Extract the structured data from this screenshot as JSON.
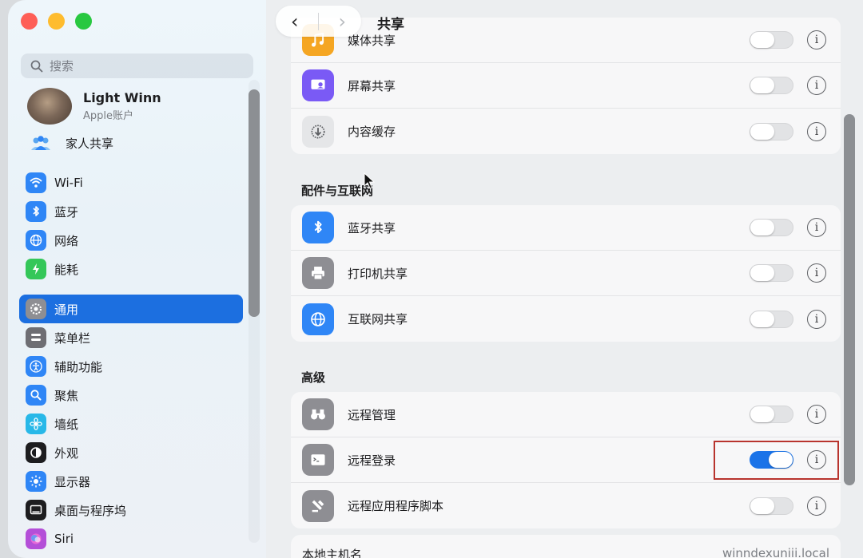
{
  "sidebar": {
    "search_placeholder": "搜索",
    "account": {
      "name": "Light Winn",
      "subtitle": "Apple账户"
    },
    "family": "家人共享",
    "items": [
      {
        "label": "Wi-Fi",
        "icon": "wifi-icon",
        "color": "#2f86f6"
      },
      {
        "label": "蓝牙",
        "icon": "bluetooth-icon",
        "color": "#2f86f6"
      },
      {
        "label": "网络",
        "icon": "globe-icon",
        "color": "#2f86f6"
      },
      {
        "label": "能耗",
        "icon": "battery-icon",
        "color": "#34c759"
      },
      {
        "label": "通用",
        "icon": "gear-icon",
        "color": "#8e8e93"
      },
      {
        "label": "菜单栏",
        "icon": "menubar-icon",
        "color": "#6e6e73"
      },
      {
        "label": "辅助功能",
        "icon": "accessibility-icon",
        "color": "#2f86f6"
      },
      {
        "label": "聚焦",
        "icon": "spotlight-icon",
        "color": "#2f86f6"
      },
      {
        "label": "墙纸",
        "icon": "wallpaper-icon",
        "color": "#28b8e8"
      },
      {
        "label": "外观",
        "icon": "appearance-icon",
        "color": "#1d1d1f"
      },
      {
        "label": "显示器",
        "icon": "display-icon",
        "color": "#2f86f6"
      },
      {
        "label": "桌面与程序坞",
        "icon": "dock-icon",
        "color": "#1d1d1f"
      },
      {
        "label": "Siri",
        "icon": "siri-icon",
        "color": "#b44fd8"
      }
    ],
    "selected": "通用"
  },
  "header": {
    "title": "共享"
  },
  "groups": {
    "top": [
      {
        "label": "媒体共享",
        "on": false,
        "icon": "media-sharing-icon",
        "color": "#f5a623"
      },
      {
        "label": "屏幕共享",
        "on": false,
        "icon": "screen-sharing-icon",
        "color": "#7a5af5"
      },
      {
        "label": "内容缓存",
        "on": false,
        "icon": "content-cache-icon",
        "color": "#8e8e93"
      }
    ],
    "accessories": {
      "heading": "配件与互联网",
      "rows": [
        {
          "label": "蓝牙共享",
          "on": false,
          "icon": "bluetooth-icon",
          "color": "#2f86f6"
        },
        {
          "label": "打印机共享",
          "on": false,
          "icon": "printer-icon",
          "color": "#8e8e93"
        },
        {
          "label": "互联网共享",
          "on": false,
          "icon": "globe-icon",
          "color": "#2f86f6"
        }
      ]
    },
    "advanced": {
      "heading": "高级",
      "rows": [
        {
          "label": "远程管理",
          "on": false,
          "icon": "binoculars-icon",
          "color": "#8e8e93"
        },
        {
          "label": "远程登录",
          "on": true,
          "icon": "terminal-icon",
          "color": "#8e8e93"
        },
        {
          "label": "远程应用程序脚本",
          "on": false,
          "icon": "script-icon",
          "color": "#8e8e93"
        }
      ]
    }
  },
  "hostname": {
    "label": "本地主机名",
    "value": "winndexuniii.local"
  },
  "info_glyph": "i"
}
